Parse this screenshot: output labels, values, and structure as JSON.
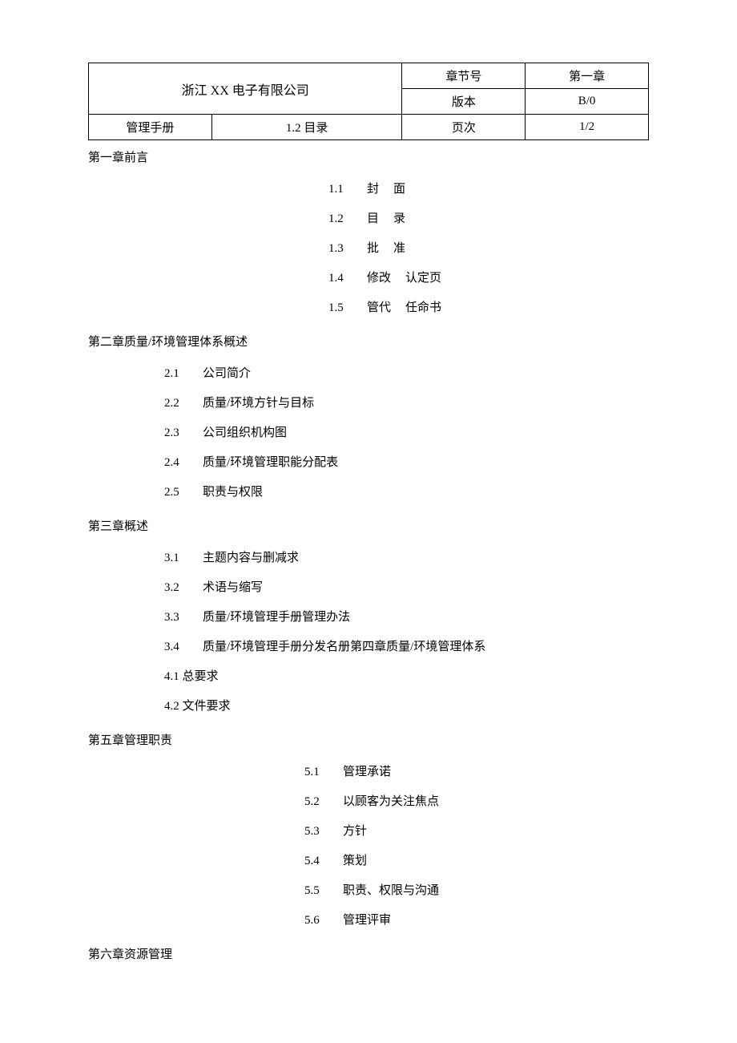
{
  "header": {
    "company": "浙江 XX 电子有限公司",
    "doc_label": "管理手册",
    "section_title": "1.2 目录",
    "meta": {
      "chapter_label": "章节号",
      "chapter_value": "第一章",
      "version_label": "版本",
      "version_value": "B/0",
      "page_label": "页次",
      "page_value": "1/2"
    }
  },
  "ch1": {
    "title": "第一章前言",
    "items": [
      {
        "num": "1.1",
        "a": "封",
        "b": "面"
      },
      {
        "num": "1.2",
        "a": "目",
        "b": "录"
      },
      {
        "num": "1.3",
        "a": "批",
        "b": "准"
      },
      {
        "num": "1.4",
        "a": "修改",
        "b": "认定页"
      },
      {
        "num": "1.5",
        "a": "管代",
        "b": "任命书"
      }
    ]
  },
  "ch2": {
    "title": "第二章质量/环境管理体系概述",
    "items": [
      {
        "num": "2.1",
        "label": "公司简介"
      },
      {
        "num": "2.2",
        "label": "质量/环境方针与目标"
      },
      {
        "num": "2.3",
        "label": "公司组织机构图"
      },
      {
        "num": "2.4",
        "label": "质量/环境管理职能分配表"
      },
      {
        "num": "2.5",
        "label": "职责与权限"
      }
    ]
  },
  "ch3": {
    "title": "第三章概述",
    "items": [
      {
        "num": "3.1",
        "label": "主题内容与删减求"
      },
      {
        "num": "3.2",
        "label": "术语与缩写"
      },
      {
        "num": "3.3",
        "label": "质量/环境管理手册管理办法"
      },
      {
        "num": "3.4",
        "label": "质量/环境管理手册分发名册第四章质量/环境管理体系"
      }
    ],
    "plain": [
      "4.1 总要求",
      "4.2 文件要求"
    ]
  },
  "ch5": {
    "title": "第五章管理职责",
    "items": [
      {
        "num": "5.1",
        "label": "管理承诺"
      },
      {
        "num": "5.2",
        "label": "以顾客为关注焦点"
      },
      {
        "num": "5.3",
        "label": "方针"
      },
      {
        "num": "5.4",
        "label": "策划"
      },
      {
        "num": "5.5",
        "label": "职责、权限与沟通"
      },
      {
        "num": "5.6",
        "label": "管理评审"
      }
    ]
  },
  "ch6": {
    "title": "第六章资源管理"
  }
}
